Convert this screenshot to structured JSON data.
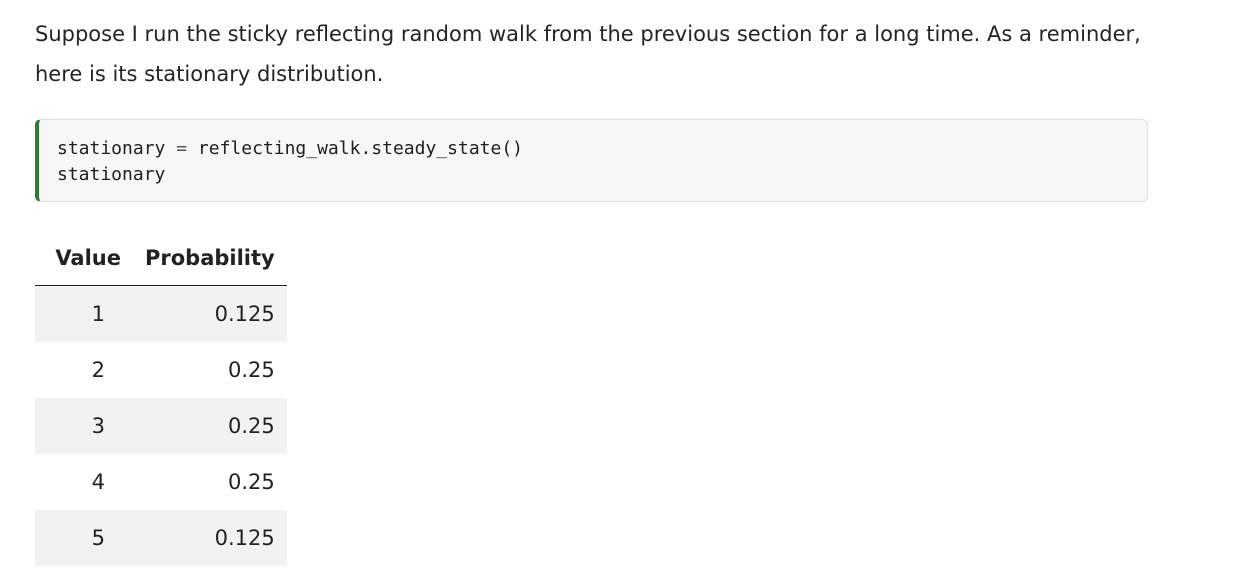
{
  "paragraph": {
    "text": "Suppose I run the sticky reflecting random walk from the previous section for a long time. As a reminder, here is its stationary distribution."
  },
  "code_cell": {
    "lines": [
      {
        "lhs": "stationary",
        "op": " = ",
        "rhs": "reflecting_walk.steady_state()"
      },
      {
        "lhs": "stationary"
      }
    ]
  },
  "output_table": {
    "headers": {
      "value": "Value",
      "probability": "Probability"
    },
    "rows": [
      {
        "value": "1",
        "probability": "0.125"
      },
      {
        "value": "2",
        "probability": "0.25"
      },
      {
        "value": "3",
        "probability": "0.25"
      },
      {
        "value": "4",
        "probability": "0.25"
      },
      {
        "value": "5",
        "probability": "0.125"
      }
    ]
  },
  "colors": {
    "code_accent": "#2e7d32",
    "code_background": "#f7f7f7",
    "row_stripe": "#f2f2f2"
  }
}
